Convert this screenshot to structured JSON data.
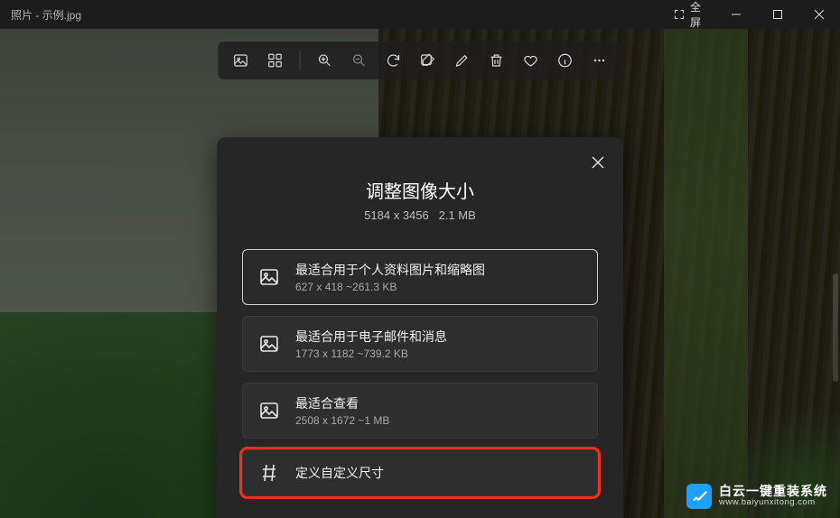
{
  "titlebar": {
    "app_title": "照片 - 示例.jpg",
    "fullscreen_label": "全屏"
  },
  "toolbar": {
    "icons": [
      "image-icon",
      "apps-icon",
      "zoom-in-icon",
      "zoom-out-icon",
      "rotate-icon",
      "edit-icon",
      "draw-icon",
      "delete-icon",
      "favorite-icon",
      "info-icon",
      "more-icon"
    ]
  },
  "dialog": {
    "title": "调整图像大小",
    "meta_dimensions": "5184 x 3456",
    "meta_size": "2.1 MB",
    "options": [
      {
        "icon": "image-icon",
        "label": "最适合用于个人资料图片和缩略图",
        "meta": "627 x 418   ~261.3 KB",
        "selected": true,
        "highlight": false
      },
      {
        "icon": "image-icon",
        "label": "最适合用于电子邮件和消息",
        "meta": "1773 x 1182   ~739.2 KB",
        "selected": false,
        "highlight": false
      },
      {
        "icon": "image-icon",
        "label": "最适合查看",
        "meta": "2508 x 1672   ~1 MB",
        "selected": false,
        "highlight": false
      },
      {
        "icon": "hash-icon",
        "label": "定义自定义尺寸",
        "meta": "",
        "selected": false,
        "highlight": true
      }
    ]
  },
  "watermark": {
    "line1": "白云一键重装系统",
    "line2": "www.baiyunxitong.com"
  }
}
